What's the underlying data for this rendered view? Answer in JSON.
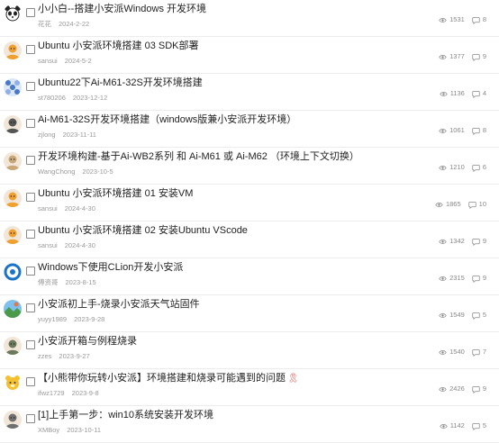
{
  "posts": [
    {
      "title": "小小白--搭建小安派Windows 开发环境",
      "author": "花花",
      "date": "2024-2-22",
      "views": "1531",
      "replies": "8",
      "avatar_icon": "panda-avatar-icon",
      "avatar_color": "#222222"
    },
    {
      "title": "Ubuntu 小安派环境搭建 03 SDK部署",
      "author": "sansui",
      "date": "2024-5-2",
      "views": "1377",
      "replies": "9",
      "avatar_icon": "person-avatar-icon",
      "avatar_color": "#f0a030"
    },
    {
      "title": "Ubuntu22下Ai-M61-32S开发环境搭建",
      "author": "st780206",
      "date": "2023-12-12",
      "views": "1136",
      "replies": "4",
      "avatar_icon": "pattern-avatar-icon",
      "avatar_color": "#4a78c8"
    },
    {
      "title": "Ai-M61-32S开发环境搭建（windows版兼小安派开发环境）",
      "author": "zjlong",
      "date": "2023-11-11",
      "views": "1061",
      "replies": "8",
      "avatar_icon": "person-avatar-icon",
      "avatar_color": "#555555"
    },
    {
      "title": "开发环境构建-基于Ai-WB2系列 和 Ai-M61 或 Ai-M62 （环境上下文切换）",
      "author": "WangChong",
      "date": "2023-10-5",
      "views": "1210",
      "replies": "6",
      "avatar_icon": "person-avatar-icon",
      "avatar_color": "#c8a878"
    },
    {
      "title": "Ubuntu 小安派环境搭建 01 安装VM",
      "author": "sansui",
      "date": "2024-4-30",
      "views": "1865",
      "replies": "10",
      "avatar_icon": "person-avatar-icon",
      "avatar_color": "#f0a030"
    },
    {
      "title": "Ubuntu 小安派环境搭建 02 安装Ubuntu VScode",
      "author": "sansui",
      "date": "2024-4-30",
      "views": "1342",
      "replies": "9",
      "avatar_icon": "person-avatar-icon",
      "avatar_color": "#f0a030"
    },
    {
      "title": "Windows下使用CLion开发小安派",
      "author": "傅资哥",
      "date": "2023-8-15",
      "views": "2315",
      "replies": "9",
      "avatar_icon": "ring-avatar-icon",
      "avatar_color": "#1a73c8"
    },
    {
      "title": "小安派初上手-烧录小安派天气站固件",
      "author": "yuyy1989",
      "date": "2023-9-28",
      "views": "1549",
      "replies": "5",
      "avatar_icon": "landscape-avatar-icon",
      "avatar_color": "#e07850"
    },
    {
      "title": "小安派开箱与例程烧录",
      "author": "zzes",
      "date": "2023-9-27",
      "views": "1540",
      "replies": "7",
      "avatar_icon": "person-avatar-icon",
      "avatar_color": "#6a7a5a"
    },
    {
      "title": "【小熊带你玩转小安派】环境搭建和烧录可能遇到的问题",
      "author": "ifwz1729",
      "date": "2023-9-8",
      "views": "2426",
      "replies": "9",
      "avatar_icon": "bear-avatar-icon",
      "avatar_color": "#f5c030",
      "badge": "medal-icon"
    },
    {
      "title": "[1]上手第一步：win10系统安装开发环境",
      "author": "XMBoy",
      "date": "2023-10-11",
      "views": "1142",
      "replies": "5",
      "avatar_icon": "person-avatar-icon",
      "avatar_color": "#707070"
    }
  ],
  "colors": {
    "title": "#1f1f1f",
    "meta": "#9a9a9a",
    "divider": "#ececec"
  },
  "icons": {
    "views": "eye-icon",
    "replies": "comment-icon"
  }
}
